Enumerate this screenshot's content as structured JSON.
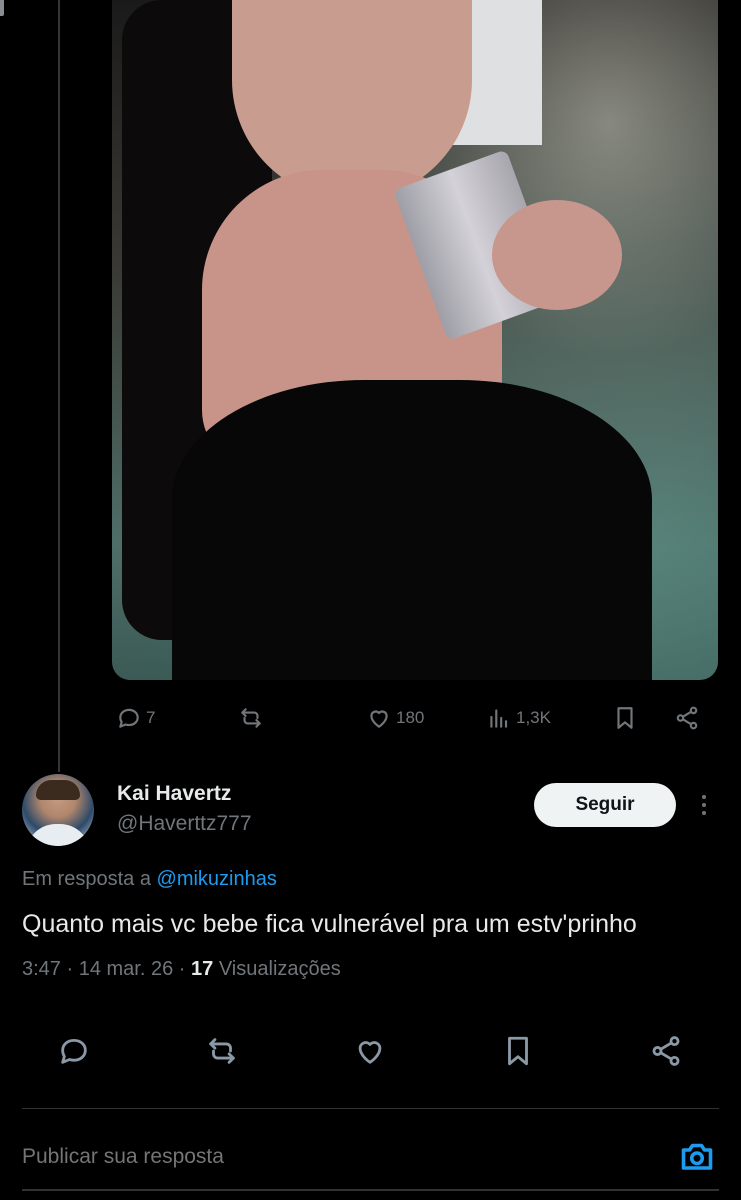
{
  "parent_tweet": {
    "actions": {
      "replies": "7",
      "retweets": "",
      "likes": "180",
      "views": "1,3K"
    }
  },
  "reply": {
    "author": {
      "name": "Kai Havertz",
      "handle": "@Haverttz777"
    },
    "follow_label": "Seguir",
    "replying_to_prefix": "Em resposta a",
    "replying_to_handle": "@mikuzinhas",
    "text": "Quanto mais vc bebe fica vulnerável pra um estv'prinho",
    "time": "3:47",
    "date": "14 mar. 26",
    "views_count": "17",
    "views_label": "Visualizações"
  },
  "composer": {
    "placeholder": "Publicar sua resposta"
  },
  "colors": {
    "background": "#000000",
    "text": "#e7e9ea",
    "secondary": "#71767b",
    "accent": "#1d9bf0"
  },
  "icons": [
    "reply-icon",
    "retweet-icon",
    "like-icon",
    "views-icon",
    "bookmark-icon",
    "share-icon",
    "more-icon",
    "camera-icon"
  ]
}
